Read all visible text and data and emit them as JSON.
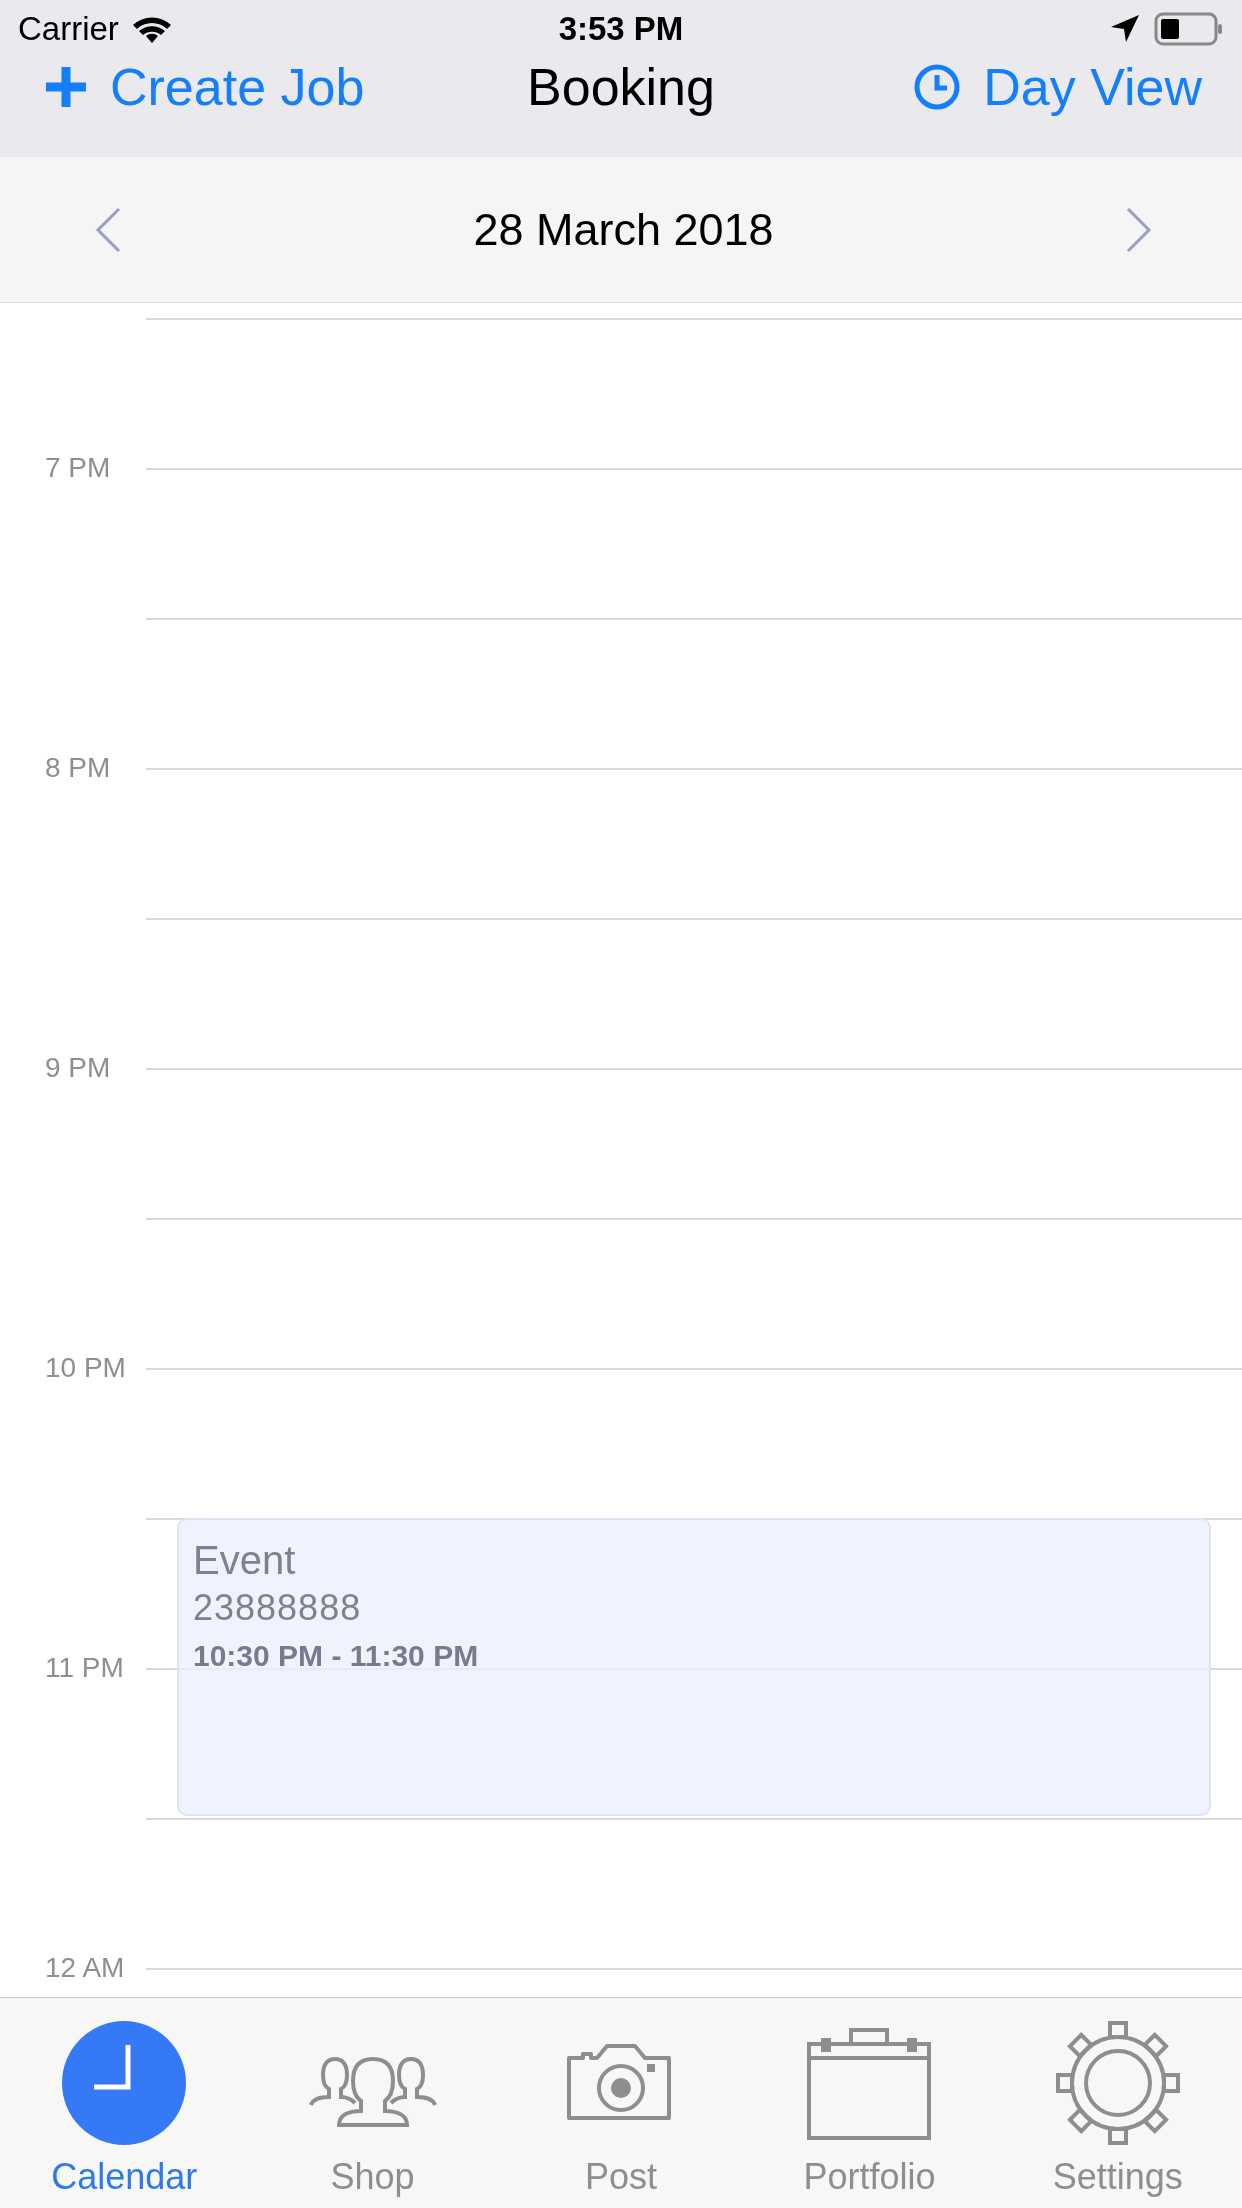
{
  "status_bar": {
    "carrier": "Carrier",
    "time": "3:53 PM"
  },
  "nav": {
    "left": "Create Job",
    "title": "Booking",
    "right": "Day View"
  },
  "date_bar": {
    "date": "28 March 2018"
  },
  "timeline": {
    "hours": [
      "7 PM",
      "8 PM",
      "9 PM",
      "10 PM",
      "11 PM",
      "12 AM"
    ],
    "event": {
      "title": "Event",
      "subtitle": "23888888",
      "time": "10:30 PM - 11:30 PM"
    }
  },
  "tabs": [
    {
      "label": "Calendar",
      "kind": "calendar",
      "selected": true
    },
    {
      "label": "Shop",
      "kind": "people",
      "selected": false
    },
    {
      "label": "Post",
      "kind": "camera",
      "selected": false
    },
    {
      "label": "Portfolio",
      "kind": "briefcase",
      "selected": false
    },
    {
      "label": "Settings",
      "kind": "gear",
      "selected": false
    }
  ]
}
